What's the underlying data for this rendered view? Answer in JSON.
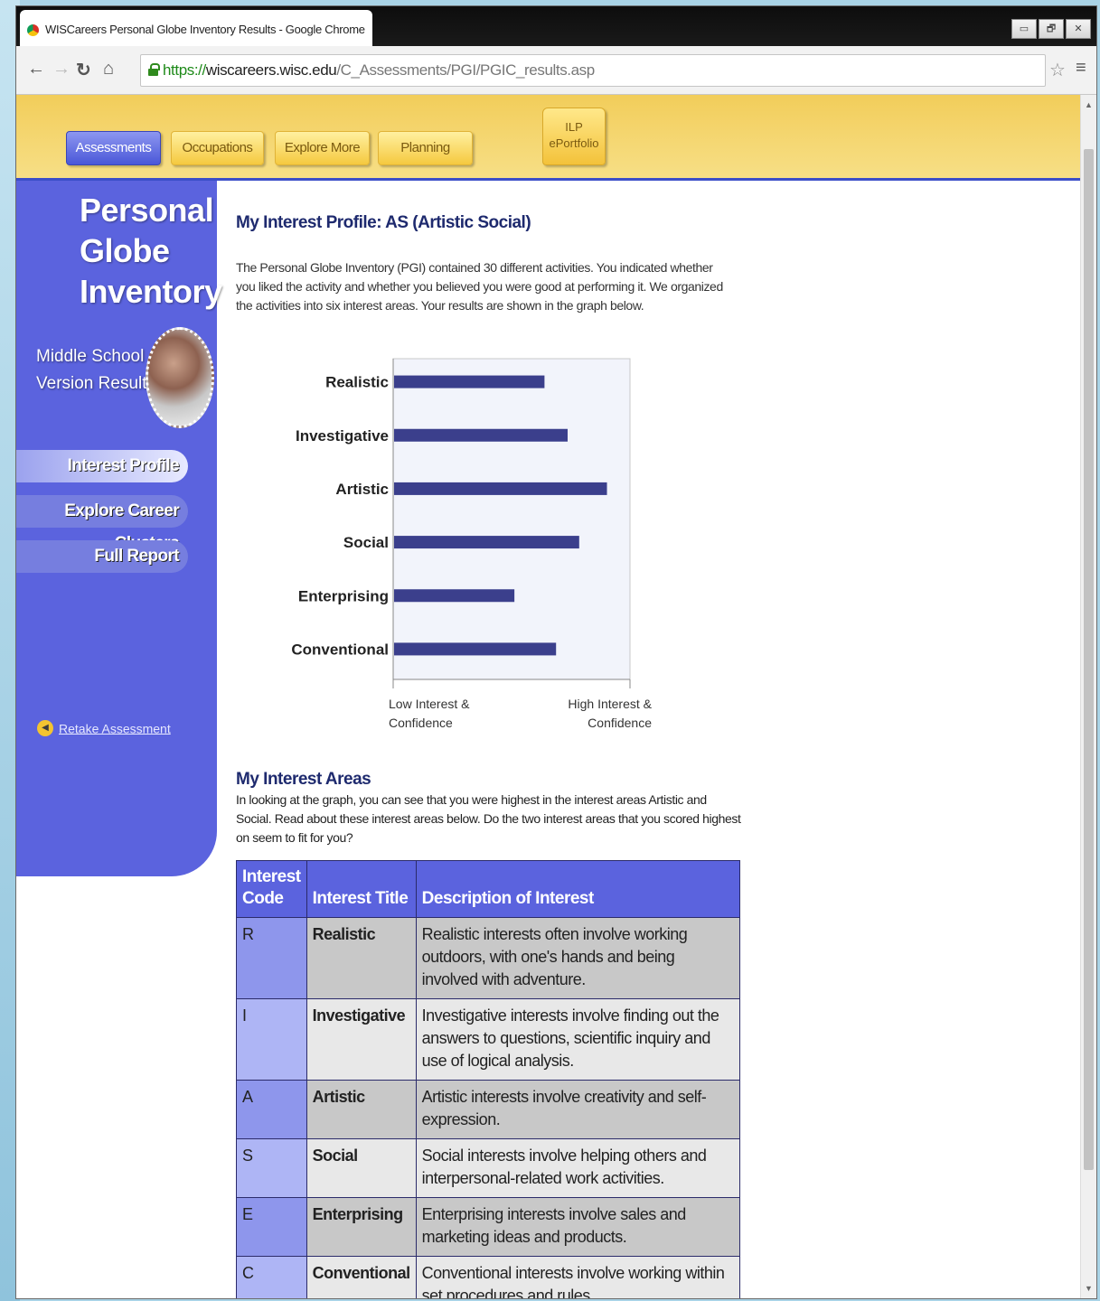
{
  "browser": {
    "tab_title": "WISCareers Personal Globe Inventory Results - Google Chrome",
    "url_scheme": "https://",
    "url_host": "wiscareers.wisc.edu",
    "url_path": "/C_Assessments/PGI/PGIC_results.asp",
    "window_buttons": [
      "▭",
      "🗗",
      "✕"
    ]
  },
  "site_nav": {
    "tabs": [
      {
        "label": "Assessments",
        "active": true
      },
      {
        "label": "Occupations",
        "active": false
      },
      {
        "label": "Explore More",
        "active": false
      },
      {
        "label": "Planning",
        "active": false
      }
    ],
    "ilp_line1": "ILP",
    "ilp_line2": "ePortfolio"
  },
  "sidebar": {
    "title_line1": "Personal",
    "title_line2": "Globe",
    "title_line3": "Inventory",
    "subtitle_line1": "Middle School",
    "subtitle_line2": "Version Results",
    "items": [
      {
        "label": "Interest Profile",
        "active": true
      },
      {
        "label": "Explore Career Clusters",
        "active": false
      },
      {
        "label": "Full Report",
        "active": false
      }
    ],
    "retake_label": "Retake Assessment"
  },
  "main": {
    "heading": "My Interest Profile: AS (Artistic Social)",
    "intro": "The Personal Globe Inventory (PGI) contained 30 different activities. You indicated whether you liked the activity and whether you believed you were good at performing it. We organized the activities into six interest areas. Your results are shown in the graph below.",
    "areas_heading": "My Interest Areas",
    "areas_text": "In looking at the graph, you can see that you were highest in the interest areas Artistic and Social. Read about these interest areas below. Do the two interest areas that you scored highest on seem to fit for you?"
  },
  "chart_data": {
    "type": "bar",
    "orientation": "horizontal",
    "categories": [
      "Realistic",
      "Investigative",
      "Artistic",
      "Social",
      "Enterprising",
      "Conventional"
    ],
    "values": [
      0.65,
      0.75,
      0.92,
      0.8,
      0.52,
      0.7
    ],
    "xlim": [
      0,
      1
    ],
    "x_axis_labels": {
      "low_line1": "Low Interest &",
      "low_line2": "Confidence",
      "high_line1": "High Interest &",
      "high_line2": "Confidence"
    },
    "bar_color": "#3b3f8c",
    "plot_background": "#f2f4fb"
  },
  "table": {
    "headers": {
      "code_line1": "Interest",
      "code_line2": "Code",
      "title": "Interest Title",
      "desc": "Description of Interest"
    },
    "rows": [
      {
        "code": "R",
        "title": "Realistic",
        "desc": "Realistic interests often involve working outdoors, with one's hands and being involved with adventure."
      },
      {
        "code": "I",
        "title": "Investigative",
        "desc": "Investigative interests involve finding out the answers to questions, scientific inquiry and use of logical analysis."
      },
      {
        "code": "A",
        "title": "Artistic",
        "desc": "Artistic interests involve creativity and self-expression."
      },
      {
        "code": "S",
        "title": "Social",
        "desc": "Social interests involve helping others and interpersonal-related work activities."
      },
      {
        "code": "E",
        "title": "Enterprising",
        "desc": "Enterprising interests involve sales and marketing ideas and products."
      },
      {
        "code": "C",
        "title": "Conventional",
        "desc": "Conventional interests involve working within set procedures and rules."
      }
    ]
  },
  "colors": {
    "accent": "#5b63de",
    "header": "#f2cd5a",
    "heading": "#1e2a6e"
  }
}
